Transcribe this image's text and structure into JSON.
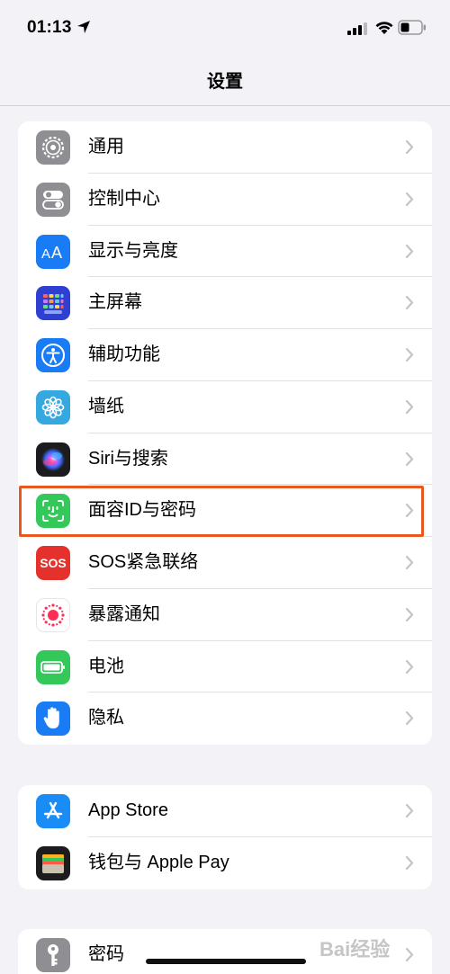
{
  "status_bar": {
    "time": "01:13",
    "location_icon": "location-arrow-icon",
    "signal_icon": "cellular-signal-icon",
    "wifi_icon": "wifi-icon",
    "battery_icon": "battery-icon"
  },
  "nav": {
    "title": "设置"
  },
  "groups": [
    {
      "items": [
        {
          "label": "通用",
          "icon": "gear-icon",
          "color": "#8e8e93"
        },
        {
          "label": "控制中心",
          "icon": "toggles-icon",
          "color": "#8e8e93"
        },
        {
          "label": "显示与亮度",
          "icon": "text-size-icon",
          "color": "#1a7cf5"
        },
        {
          "label": "主屏幕",
          "icon": "home-grid-icon",
          "color": "#2f3fd1"
        },
        {
          "label": "辅助功能",
          "icon": "accessibility-icon",
          "color": "#1a7cf5"
        },
        {
          "label": "墙纸",
          "icon": "flower-icon",
          "color": "#35a8e0"
        },
        {
          "label": "Siri与搜索",
          "icon": "siri-icon",
          "color": "#1c1c1e"
        },
        {
          "label": "面容ID与密码",
          "icon": "face-id-icon",
          "color": "#34c759"
        },
        {
          "label": "SOS紧急联络",
          "icon": "sos-icon",
          "color": "#e5312b",
          "icon_text": "SOS"
        },
        {
          "label": "暴露通知",
          "icon": "exposure-icon",
          "color": "#ffffff"
        },
        {
          "label": "电池",
          "icon": "battery-setting-icon",
          "color": "#34c759"
        },
        {
          "label": "隐私",
          "icon": "hand-icon",
          "color": "#1a7cf5"
        }
      ]
    },
    {
      "items": [
        {
          "label": "App Store",
          "icon": "app-store-icon",
          "color": "#1a8cf5"
        },
        {
          "label": "钱包与 Apple Pay",
          "icon": "wallet-icon",
          "color": "#1c1c1e"
        }
      ]
    },
    {
      "items": [
        {
          "label": "密码",
          "icon": "key-icon",
          "color": "#8e8e93"
        }
      ]
    }
  ],
  "highlight_color": "#e8581f",
  "watermark": "Bai经验"
}
